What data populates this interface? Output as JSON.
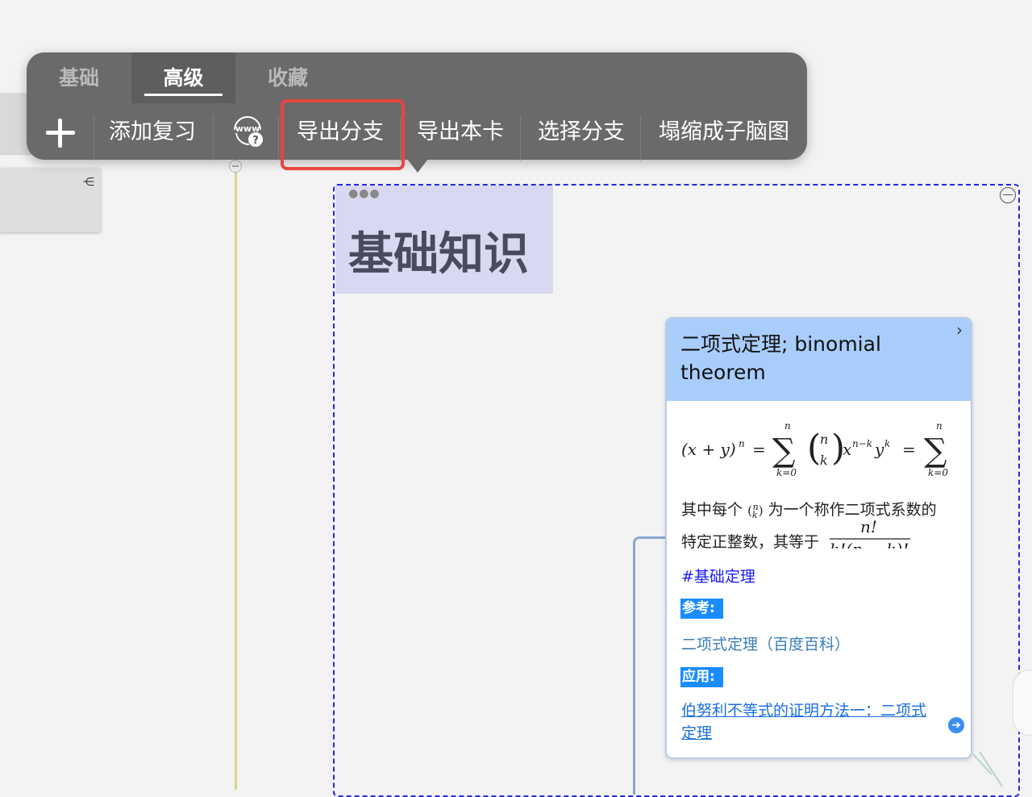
{
  "toolbar": {
    "tabs": [
      {
        "label": "基础",
        "active": false
      },
      {
        "label": "高级",
        "active": true
      },
      {
        "label": "收藏",
        "active": false
      }
    ],
    "buttons": {
      "add_review": "添加复习",
      "export_branch": "导出分支",
      "export_card": "导出本卡",
      "select_branch": "选择分支",
      "collapse_submap": "塌缩成子脑图"
    },
    "www_icon_text": "www"
  },
  "group": {
    "title": "基础知识"
  },
  "card": {
    "title": "二项式定理; binomial theorem",
    "body_line1": "其中每个",
    "body_line1_rest": "为一个称作二项式系数的",
    "body_line2": "特定正整数，其等于",
    "hashtag": "#基础定理",
    "label_ref": "参考:",
    "ref_link": "二项式定理（百度百科）",
    "label_app": "应用:",
    "app_link": "伯努利不等式的证明方法一：二项式定理"
  },
  "colors": {
    "toolbar_bg": "#6a6a6a",
    "highlight": "#e8463f",
    "group_border": "#2727e0",
    "card_header": "#a9cdfb",
    "label_bg": "#1a8cff"
  }
}
